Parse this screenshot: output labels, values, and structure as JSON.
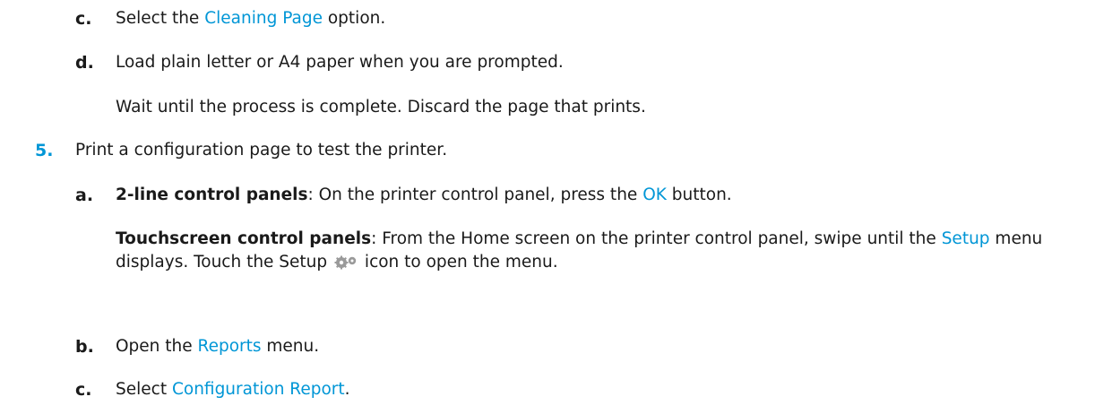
{
  "steps": {
    "c1": {
      "marker": "c.",
      "pre": "Select the ",
      "link": "Cleaning Page",
      "post": " option."
    },
    "d1": {
      "marker": "d.",
      "text": "Load plain letter or A4 paper when you are prompted.",
      "note": "Wait until the process is complete. Discard the page that prints."
    },
    "s5": {
      "marker": "5.",
      "text": "Print a configuration page to test the printer."
    },
    "a2": {
      "marker": "a.",
      "bold_label": "2-line control panels",
      "pre": ": On the printer control panel, press the ",
      "link": "OK",
      "post": " button.",
      "touch_label": "Touchscreen control panels",
      "touch_pre": ": From the Home screen on the printer control panel, swipe until the ",
      "touch_link": "Setup",
      "touch_mid": " menu displays. Touch the Setup ",
      "touch_post": " icon to open the menu."
    },
    "b2": {
      "marker": "b.",
      "pre": "Open the ",
      "link": "Reports",
      "post": " menu."
    },
    "c2": {
      "marker": "c.",
      "pre": "Select ",
      "link": "Configuration Report",
      "post": "."
    }
  },
  "icons": {
    "setup": "gear-icon"
  },
  "colors": {
    "link": "#0096d6",
    "text": "#1a1a1a"
  }
}
